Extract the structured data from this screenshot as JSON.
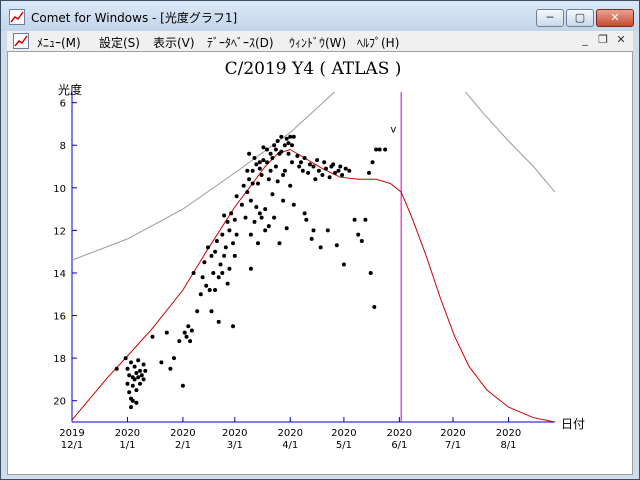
{
  "window": {
    "title": "Comet for Windows - [光度グラフ1]",
    "icon": "graph-window-icon",
    "controls": {
      "minimize": "─",
      "maximize": "▢",
      "close": "✕"
    }
  },
  "menu": {
    "items": [
      {
        "label": "ﾒﾆｭｰ(M)"
      },
      {
        "label": "設定(S)"
      },
      {
        "label": "表示(V)"
      },
      {
        "label": "ﾃﾞｰﾀﾍﾞｰｽ(D)"
      },
      {
        "label": "ｳｨﾝﾄﾞｳ(W)"
      },
      {
        "label": "ﾍﾙﾌﾟ(H)"
      }
    ],
    "mdi_controls": {
      "minimize": "_",
      "restore": "❐",
      "close": "✕"
    }
  },
  "colors": {
    "accent_axis": "#0000cc",
    "prediction_curve": "#cc0000",
    "marker_line": "#cc00cc",
    "reference_curve": "#9a9a9a",
    "points": "#000000"
  },
  "chart_data": {
    "type": "scatter",
    "title": "C/2019 Y4 ( ATLAS )",
    "ylabel": "光度",
    "xlabel": "日付",
    "y_inverted": true,
    "ylim": [
      21,
      5.5
    ],
    "yticks": [
      6,
      8,
      10,
      12,
      14,
      16,
      18,
      20
    ],
    "x_unit": "days from 2019-12-01",
    "xlim": [
      0,
      270
    ],
    "xticks": [
      {
        "year": "2019",
        "md": "12/1",
        "x": 0
      },
      {
        "year": "2020",
        "md": "1/1",
        "x": 31
      },
      {
        "year": "2020",
        "md": "2/1",
        "x": 62
      },
      {
        "year": "2020",
        "md": "3/1",
        "x": 91
      },
      {
        "year": "2020",
        "md": "4/1",
        "x": 122
      },
      {
        "year": "2020",
        "md": "5/1",
        "x": 152
      },
      {
        "year": "2020",
        "md": "6/1",
        "x": 183
      },
      {
        "year": "2020",
        "md": "7/1",
        "x": 213
      },
      {
        "year": "2020",
        "md": "8/1",
        "x": 244
      }
    ],
    "today_marker_x": 184,
    "annotation": {
      "text": "v",
      "x": 178,
      "y": 7.4
    },
    "series": [
      {
        "name": "",
        "type": "line",
        "x": [
          0,
          10,
          20,
          31,
          45,
          62,
          75,
          91,
          100,
          108,
          115,
          122,
          130,
          140,
          150,
          160,
          170,
          178,
          184,
          190,
          198,
          206,
          214,
          222,
          232,
          244,
          258,
          270
        ],
        "y": [
          20.9,
          19.9,
          18.9,
          17.9,
          16.6,
          14.8,
          13.0,
          10.9,
          9.9,
          9.0,
          8.4,
          8.2,
          8.6,
          9.1,
          9.5,
          9.6,
          9.6,
          9.8,
          10.2,
          11.4,
          13.2,
          15.2,
          17.0,
          18.4,
          19.5,
          20.3,
          20.8,
          21.0
        ]
      },
      {
        "name": "",
        "type": "line",
        "x": [
          0,
          31,
          62,
          91,
          122,
          152
        ],
        "y": [
          13.4,
          12.4,
          11.0,
          9.3,
          7.4,
          5.1
        ]
      },
      {
        "name": "",
        "type": "line",
        "x": [
          215,
          230,
          244,
          258,
          270
        ],
        "y": [
          5.0,
          6.5,
          7.8,
          9.0,
          10.2
        ]
      },
      {
        "name": "",
        "type": "scatter",
        "points": [
          [
            25,
            18.5
          ],
          [
            30,
            18.0
          ],
          [
            31,
            18.5
          ],
          [
            31,
            19.2
          ],
          [
            32,
            18.8
          ],
          [
            32,
            19.6
          ],
          [
            33,
            18.2
          ],
          [
            33,
            19.9
          ],
          [
            34,
            18.9
          ],
          [
            34,
            19.3
          ],
          [
            35,
            18.4
          ],
          [
            35,
            19.0
          ],
          [
            36,
            18.7
          ],
          [
            36,
            19.5
          ],
          [
            37,
            18.1
          ],
          [
            37,
            18.9
          ],
          [
            38,
            18.6
          ],
          [
            38,
            19.2
          ],
          [
            39,
            18.8
          ],
          [
            40,
            18.3
          ],
          [
            40,
            19.0
          ],
          [
            41,
            18.6
          ],
          [
            33,
            20.3
          ],
          [
            34,
            20.0
          ],
          [
            36,
            20.1
          ],
          [
            45,
            17.0
          ],
          [
            50,
            18.2
          ],
          [
            53,
            16.8
          ],
          [
            55,
            18.5
          ],
          [
            57,
            18.0
          ],
          [
            60,
            17.2
          ],
          [
            62,
            19.3
          ],
          [
            63,
            16.8
          ],
          [
            64,
            17.0
          ],
          [
            65,
            16.5
          ],
          [
            66,
            17.2
          ],
          [
            67,
            16.7
          ],
          [
            68,
            14.0
          ],
          [
            70,
            15.8
          ],
          [
            72,
            15.0
          ],
          [
            73,
            14.2
          ],
          [
            74,
            13.5
          ],
          [
            75,
            14.6
          ],
          [
            76,
            12.8
          ],
          [
            77,
            14.8
          ],
          [
            78,
            13.2
          ],
          [
            78,
            15.8
          ],
          [
            79,
            14.0
          ],
          [
            80,
            13.0
          ],
          [
            80,
            14.8
          ],
          [
            81,
            12.5
          ],
          [
            82,
            14.2
          ],
          [
            82,
            16.3
          ],
          [
            83,
            13.6
          ],
          [
            84,
            12.2
          ],
          [
            84,
            14.0
          ],
          [
            85,
            11.3
          ],
          [
            85,
            13.2
          ],
          [
            86,
            12.8
          ],
          [
            87,
            11.6
          ],
          [
            87,
            14.5
          ],
          [
            88,
            12.0
          ],
          [
            88,
            13.8
          ],
          [
            89,
            11.2
          ],
          [
            90,
            12.6
          ],
          [
            90,
            16.5
          ],
          [
            91,
            11.5
          ],
          [
            91,
            13.2
          ],
          [
            92,
            10.4
          ],
          [
            92,
            12.2
          ],
          [
            95,
            10.8
          ],
          [
            96,
            9.9
          ],
          [
            97,
            11.4
          ],
          [
            98,
            10.2
          ],
          [
            99,
            9.6
          ],
          [
            100,
            10.6
          ],
          [
            100,
            12.2
          ],
          [
            101,
            9.2
          ],
          [
            102,
            11.6
          ],
          [
            103,
            8.9
          ],
          [
            104,
            9.8
          ],
          [
            105,
            8.8
          ],
          [
            105,
            11.2
          ],
          [
            106,
            9.4
          ],
          [
            107,
            8.7
          ],
          [
            108,
            11.0
          ],
          [
            109,
            8.2
          ],
          [
            110,
            9.6
          ],
          [
            111,
            8.4
          ],
          [
            112,
            10.3
          ],
          [
            113,
            8.0
          ],
          [
            114,
            9.0
          ],
          [
            115,
            7.8
          ],
          [
            116,
            8.4
          ],
          [
            117,
            7.6
          ],
          [
            118,
            9.4
          ],
          [
            119,
            8.0
          ],
          [
            120,
            7.7
          ],
          [
            121,
            8.4
          ],
          [
            122,
            7.6
          ],
          [
            123,
            8.8
          ],
          [
            124,
            7.6
          ],
          [
            98,
            9.2
          ],
          [
            99,
            8.4
          ],
          [
            100,
            13.8
          ],
          [
            101,
            9.8
          ],
          [
            102,
            8.6
          ],
          [
            103,
            10.9
          ],
          [
            104,
            12.6
          ],
          [
            105,
            9.1
          ],
          [
            106,
            11.4
          ],
          [
            107,
            8.1
          ],
          [
            108,
            12.0
          ],
          [
            109,
            8.8
          ],
          [
            110,
            11.8
          ],
          [
            111,
            9.2
          ],
          [
            112,
            8.6
          ],
          [
            113,
            11.4
          ],
          [
            114,
            8.2
          ],
          [
            115,
            9.7
          ],
          [
            116,
            12.6
          ],
          [
            117,
            8.3
          ],
          [
            118,
            10.6
          ],
          [
            119,
            9.2
          ],
          [
            120,
            11.9
          ],
          [
            121,
            7.9
          ],
          [
            122,
            9.9
          ],
          [
            123,
            8.0
          ],
          [
            124,
            10.8
          ],
          [
            126,
            8.5
          ],
          [
            127,
            9.0
          ],
          [
            128,
            8.8
          ],
          [
            129,
            9.2
          ],
          [
            130,
            8.6
          ],
          [
            131,
            11.5
          ],
          [
            132,
            9.3
          ],
          [
            133,
            8.9
          ],
          [
            134,
            12.4
          ],
          [
            135,
            9.0
          ],
          [
            136,
            9.6
          ],
          [
            137,
            8.7
          ],
          [
            138,
            9.2
          ],
          [
            139,
            12.8
          ],
          [
            140,
            9.4
          ],
          [
            141,
            8.8
          ],
          [
            142,
            9.1
          ],
          [
            143,
            12.0
          ],
          [
            144,
            9.5
          ],
          [
            145,
            9.0
          ],
          [
            146,
            8.9
          ],
          [
            147,
            9.3
          ],
          [
            148,
            12.7
          ],
          [
            149,
            9.2
          ],
          [
            150,
            9.0
          ],
          [
            151,
            9.4
          ],
          [
            152,
            13.6
          ],
          [
            153,
            9.1
          ],
          [
            155,
            9.2
          ],
          [
            158,
            11.5
          ],
          [
            160,
            12.2
          ],
          [
            162,
            12.5
          ],
          [
            164,
            11.5
          ],
          [
            166,
            9.3
          ],
          [
            168,
            8.8
          ],
          [
            170,
            8.2
          ],
          [
            172,
            8.2
          ],
          [
            175,
            8.2
          ],
          [
            167,
            14.0
          ],
          [
            169,
            15.6
          ],
          [
            130,
            11.2
          ],
          [
            135,
            12.0
          ]
        ]
      }
    ]
  }
}
